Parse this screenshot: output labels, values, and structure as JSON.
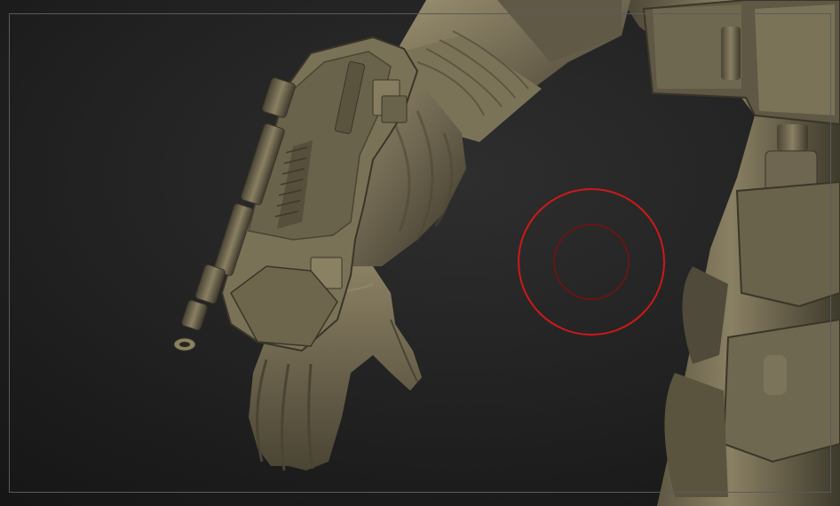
{
  "viewport": {
    "background_top": "#2e2e2e",
    "background_bottom": "#141414",
    "frame_color": "#5a5a5a"
  },
  "model": {
    "material_base": "#6e6650",
    "material_highlight": "#9a9070",
    "material_shadow": "#3a3528"
  },
  "brush_cursor": {
    "outer_color": "#d01818",
    "inner_color": "#7a1010"
  }
}
